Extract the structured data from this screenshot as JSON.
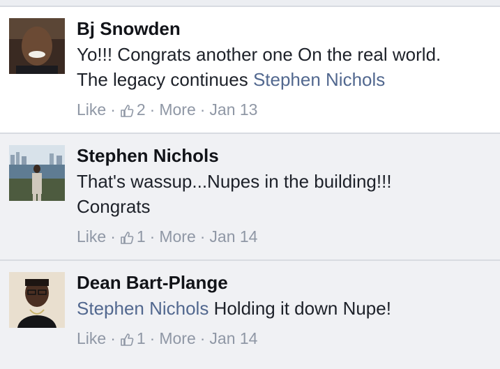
{
  "comments": [
    {
      "author": "Bj Snowden",
      "text_lines": [
        {
          "before": "Yo!!! Congrats another one On the real world.",
          "mention": "",
          "after": ""
        },
        {
          "before": "The legacy continues ",
          "mention": "Stephen Nichols",
          "after": ""
        }
      ],
      "like_label": "Like",
      "like_count": "2",
      "more_label": "More",
      "date": "Jan 13",
      "avatar_icon": "profile-photo"
    },
    {
      "author": "Stephen Nichols",
      "text_lines": [
        {
          "before": "That's wassup...Nupes in the building!!!",
          "mention": "",
          "after": ""
        },
        {
          "before": "Congrats",
          "mention": "",
          "after": ""
        }
      ],
      "like_label": "Like",
      "like_count": "1",
      "more_label": "More",
      "date": "Jan 14",
      "avatar_icon": "profile-photo"
    },
    {
      "author": "Dean Bart-Plange",
      "text_lines": [
        {
          "before": "",
          "mention": "Stephen Nichols",
          "after": " Holding it down Nupe!"
        }
      ],
      "like_label": "Like",
      "like_count": "1",
      "more_label": "More",
      "date": "Jan 14",
      "avatar_icon": "profile-photo"
    }
  ],
  "colors": {
    "mention": "#52688f",
    "meta": "#8f97a5",
    "author": "#111318"
  }
}
